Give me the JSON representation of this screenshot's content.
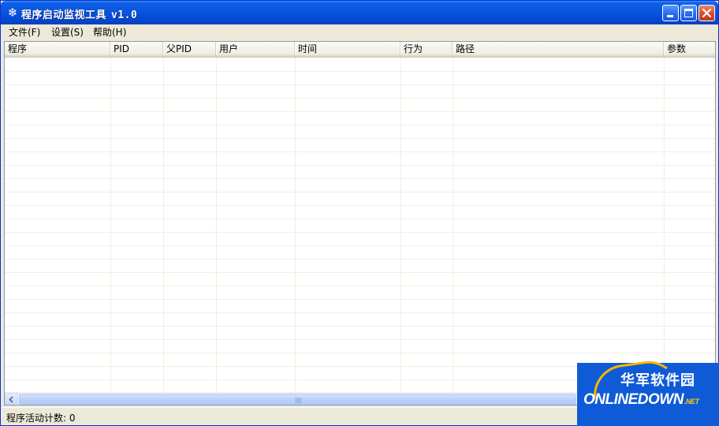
{
  "window": {
    "title": "程序启动监视工具",
    "version": "v1.0",
    "icon": "snowflake-icon"
  },
  "menu": {
    "items": [
      {
        "label": "文件(F)"
      },
      {
        "label": "设置(S)"
      },
      {
        "label": "帮助(H)"
      }
    ]
  },
  "list": {
    "columns": [
      {
        "label": "程序"
      },
      {
        "label": "PID"
      },
      {
        "label": "父PID"
      },
      {
        "label": "用户"
      },
      {
        "label": "时间"
      },
      {
        "label": "行为"
      },
      {
        "label": "路径"
      },
      {
        "label": "参数"
      }
    ],
    "rows": []
  },
  "status": {
    "text": "程序活动计数: 0"
  },
  "watermark": {
    "cn": "华军软件园",
    "en": "ONLINEDOWN",
    "suffix": ".NET"
  }
}
